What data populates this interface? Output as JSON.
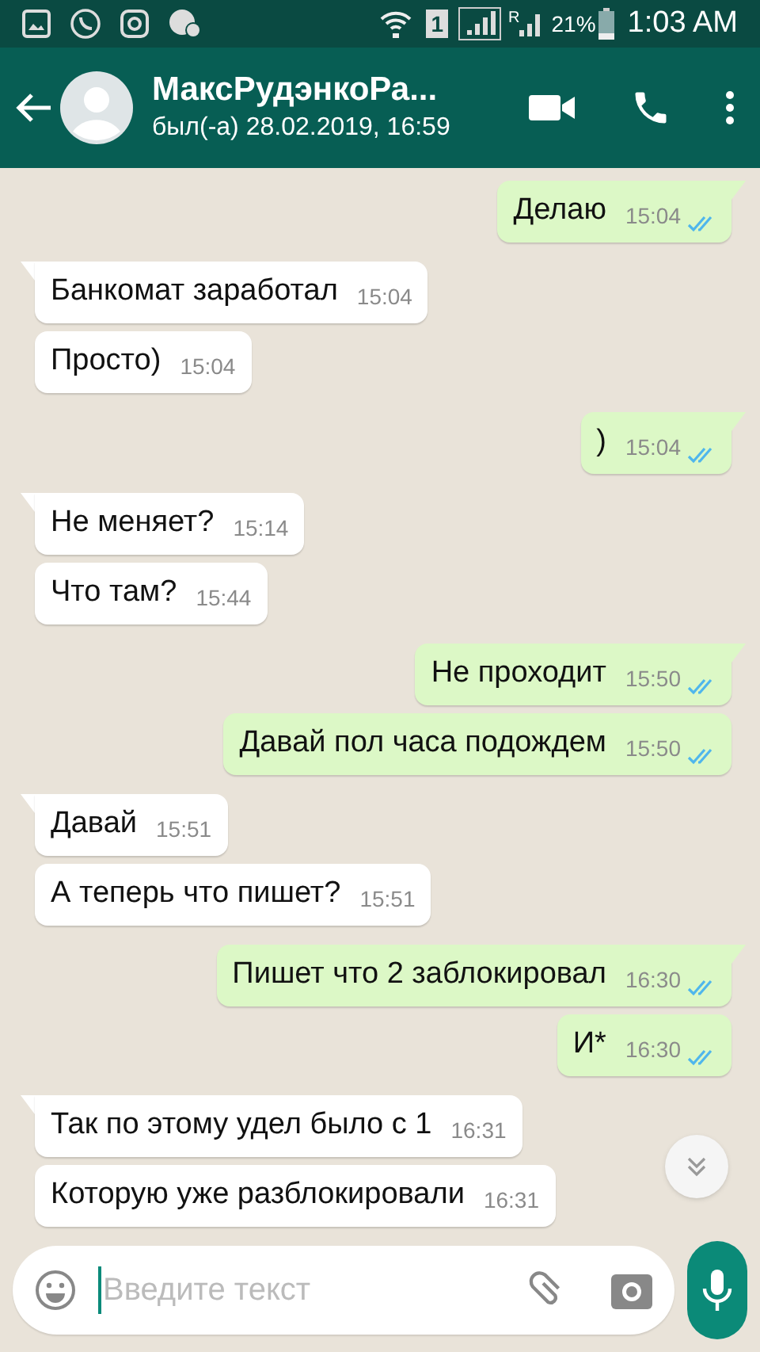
{
  "status_bar": {
    "sim": "1",
    "roaming": "R",
    "battery": "21%",
    "time": "1:03 AM"
  },
  "header": {
    "name": "МаксРудэнкоРа...",
    "status": "был(-а) 28.02.2019, 16:59"
  },
  "messages": [
    {
      "text": "Делаю",
      "time": "15:04",
      "outgoing": true,
      "tail": true,
      "read": true
    },
    {
      "text": "Банкомат заработал",
      "time": "15:04",
      "outgoing": false,
      "tail": true
    },
    {
      "text": "Просто)",
      "time": "15:04",
      "outgoing": false,
      "tail": false
    },
    {
      "text": ")",
      "time": "15:04",
      "outgoing": true,
      "tail": true,
      "read": true
    },
    {
      "text": "Не меняет?",
      "time": "15:14",
      "outgoing": false,
      "tail": true
    },
    {
      "text": "Что там?",
      "time": "15:44",
      "outgoing": false,
      "tail": false
    },
    {
      "text": "Не проходит",
      "time": "15:50",
      "outgoing": true,
      "tail": true,
      "read": true
    },
    {
      "text": "Давай пол часа подождем",
      "time": "15:50",
      "outgoing": true,
      "tail": false,
      "read": true
    },
    {
      "text": "Давай",
      "time": "15:51",
      "outgoing": false,
      "tail": true
    },
    {
      "text": "А теперь что пишет?",
      "time": "15:51",
      "outgoing": false,
      "tail": false
    },
    {
      "text": "Пишет что 2 заблокировал",
      "time": "16:30",
      "outgoing": true,
      "tail": true,
      "read": true
    },
    {
      "text": "И*",
      "time": "16:30",
      "outgoing": true,
      "tail": false,
      "read": true
    },
    {
      "text": "Так по этому удел было с 1",
      "time": "16:31",
      "outgoing": false,
      "tail": true
    },
    {
      "text": "Которую уже разблокировали",
      "time": "16:31",
      "outgoing": false,
      "tail": false
    }
  ],
  "composer": {
    "placeholder": "Введите текст"
  }
}
